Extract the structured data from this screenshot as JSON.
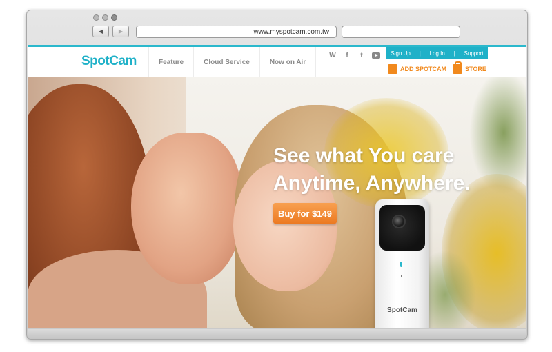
{
  "browser": {
    "url": "www.myspotcam.com.tw",
    "back_symbol": "◀",
    "forward_symbol": "▶",
    "search_value": ""
  },
  "header": {
    "logo": "SpotCam",
    "nav": [
      "Feature",
      "Cloud Service",
      "Now on Air"
    ],
    "social": [
      "W",
      "f",
      "t",
      "youtube"
    ],
    "topbar": {
      "signup": "Sign Up",
      "login": "Log In",
      "support": "Support",
      "separator": "|"
    },
    "add_spotcam": "ADD SPOTCAM",
    "store": "STORE"
  },
  "hero": {
    "headline_line1": "See what You care",
    "headline_line2": "Anytime, Anywhere.",
    "buy_button": "Buy for $149",
    "camera_brand": "SpotCam"
  },
  "colors": {
    "accent": "#1fb1c8",
    "orange": "#f1891d"
  }
}
